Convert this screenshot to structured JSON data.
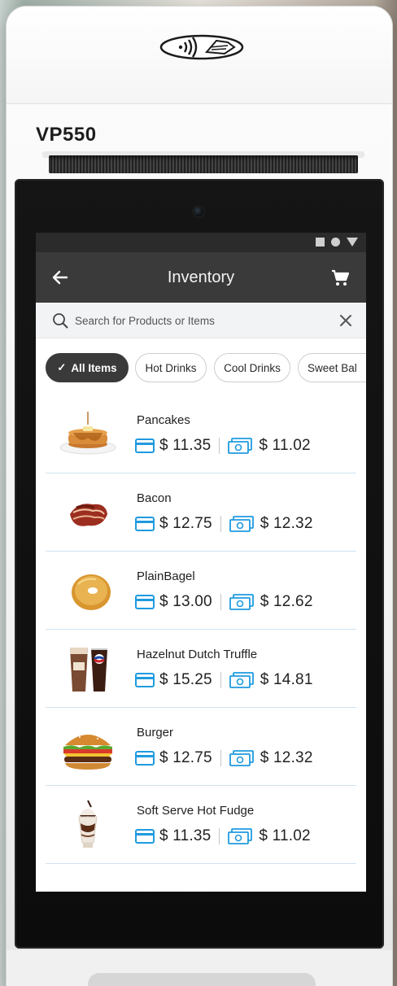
{
  "device": {
    "model": "VP550"
  },
  "appbar": {
    "title": "Inventory"
  },
  "search": {
    "placeholder": "Search for Products or Items"
  },
  "categories": [
    {
      "label": "All Items",
      "active": true
    },
    {
      "label": "Hot Drinks",
      "active": false
    },
    {
      "label": "Cool Drinks",
      "active": false
    },
    {
      "label": "Sweet Bal",
      "active": false
    }
  ],
  "items": [
    {
      "name": "Pancakes",
      "card_price": "$ 11.35",
      "cash_price": "$ 11.02",
      "image": "pancakes"
    },
    {
      "name": "Bacon",
      "card_price": "$ 12.75",
      "cash_price": "$ 12.32",
      "image": "bacon"
    },
    {
      "name": "PlainBagel",
      "card_price": "$ 13.00",
      "cash_price": "$ 12.62",
      "image": "bagel"
    },
    {
      "name": "Hazelnut Dutch Truffle",
      "card_price": "$ 15.25",
      "cash_price": "$ 14.81",
      "image": "drinks"
    },
    {
      "name": "Burger",
      "card_price": "$ 12.75",
      "cash_price": "$ 12.32",
      "image": "burger"
    },
    {
      "name": "Soft Serve Hot Fudge",
      "card_price": "$ 11.35",
      "cash_price": "$ 11.02",
      "image": "sundae"
    }
  ],
  "colors": {
    "accent": "#1e9be0",
    "appbar": "#3a3a3a",
    "divider": "#cfe2f0"
  },
  "icons": [
    "contactless-icon",
    "back-arrow-icon",
    "cart-icon",
    "search-icon",
    "close-icon",
    "check-icon",
    "card-icon",
    "cash-icon"
  ]
}
